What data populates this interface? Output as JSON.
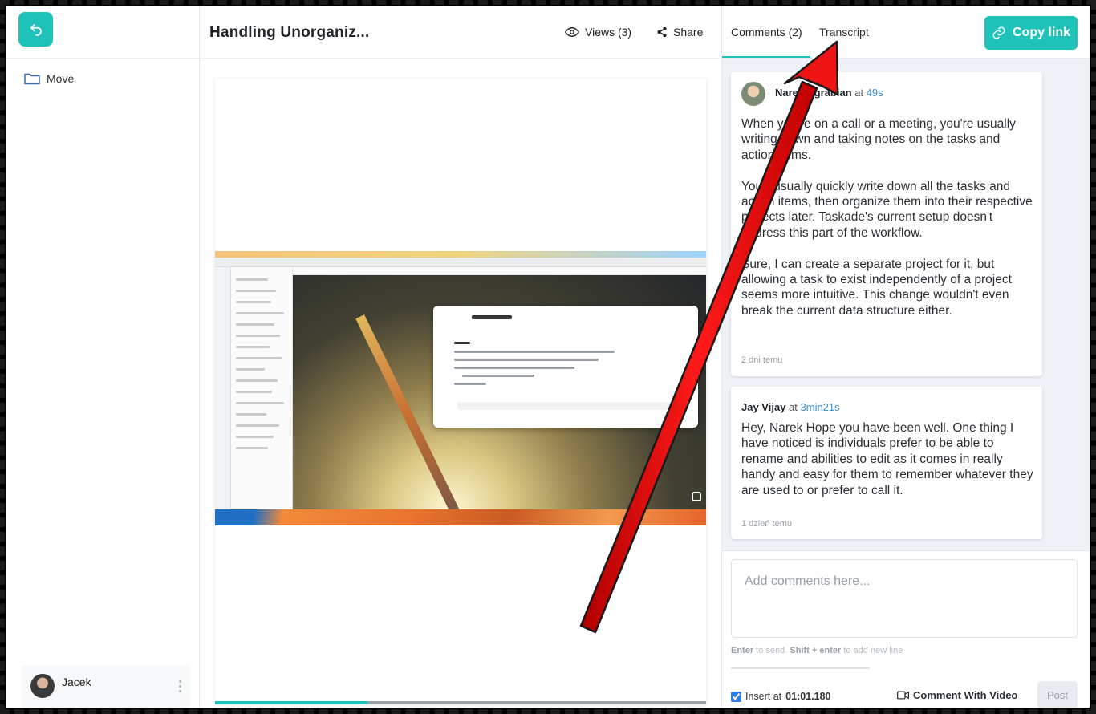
{
  "sidebar": {
    "move_label": "Move",
    "user_name": "Jacek"
  },
  "header": {
    "title": "Handling Unorganiz...",
    "views_label": "Views (3)",
    "share_label": "Share"
  },
  "player": {
    "progress": 0.31
  },
  "right_panel": {
    "tabs": [
      {
        "label": "Comments (2)"
      },
      {
        "label": "Transcript"
      }
    ],
    "copy_link_label": "Copy link"
  },
  "comments": [
    {
      "author": "Narek Agrabian",
      "at_label": "at",
      "time": "49s",
      "body": "When you're on a call or a meeting, you're usually writing down and taking notes on the tasks and action items.\n\nYou'll usually quickly write down all the tasks and action items, then organize them into their respective projects later. Taskade's current setup doesn't address this part of the workflow.\n\nSure, I can create a separate project for it, but allowing a task to exist independently of a project seems more intuitive. This change wouldn't even break the current data structure either.",
      "date": "2 dni temu"
    },
    {
      "author": "Jay Vijay",
      "at_label": "at",
      "time": "3min21s",
      "body": "Hey, Narek Hope you have been well. One thing I have noticed is individuals prefer to be able to rename and abilities to edit as it comes in really handy and easy for them to remember whatever they are used to or prefer to call it.",
      "date": "1 dzień temu"
    }
  ],
  "composer": {
    "placeholder": "Add comments here...",
    "hint_enter": "Enter",
    "hint_send": " to send. ",
    "hint_shift": "Shift + enter",
    "hint_newline": " to add new line",
    "insert_label": "Insert at",
    "insert_time": "01:01.180",
    "video_label": "Comment With Video",
    "post_label": "Post"
  },
  "colors": {
    "accent": "#1fc2b8",
    "arrow": "#e31212"
  }
}
